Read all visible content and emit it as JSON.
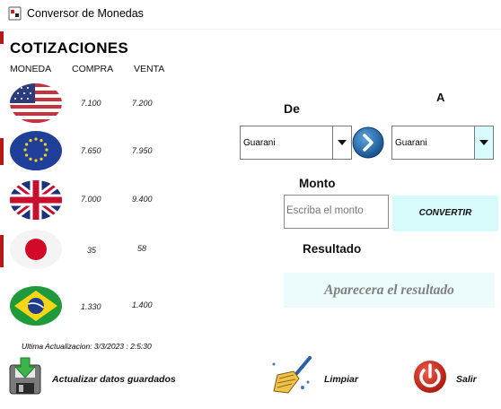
{
  "window": {
    "title": "Conversor de Monedas",
    "icon": "card-icon"
  },
  "quotes": {
    "title": "COTIZACIONES",
    "headers": {
      "currency": "MONEDA",
      "buy": "COMPRA",
      "sell": "VENTA"
    },
    "rows": [
      {
        "flag": "usa-flag-icon",
        "buy": "7.100",
        "sell": "7.200"
      },
      {
        "flag": "eu-flag-icon",
        "buy": "7.650",
        "sell": "7.950"
      },
      {
        "flag": "uk-flag-icon",
        "buy": "7.000",
        "sell": "9.400"
      },
      {
        "flag": "japan-flag-icon",
        "buy": "35",
        "sell": "58"
      },
      {
        "flag": "brazil-flag-icon",
        "buy": "1.330",
        "sell": "1.400"
      }
    ],
    "last_update": "Ultima Actualizacion: 3/3/2023 : 2:5:30"
  },
  "converter": {
    "from_label": "De",
    "to_label": "A",
    "from_value": "Guarani",
    "to_value": "Guarani",
    "amount_label": "Monto",
    "amount_placeholder": "Escriba el monto",
    "convert_label": "CONVERTIR",
    "result_label": "Resultado",
    "result_text": "Aparecera el resultado"
  },
  "actions": {
    "update_label": "Actualizar datos guardados",
    "clear_label": "Limpiar",
    "exit_label": "Salir"
  },
  "colors": {
    "accent_cyan": "#d7fbfb",
    "result_bg": "#ecfbfb",
    "swap_button": "#1a5fa0",
    "exit_red": "#d42a1e"
  }
}
